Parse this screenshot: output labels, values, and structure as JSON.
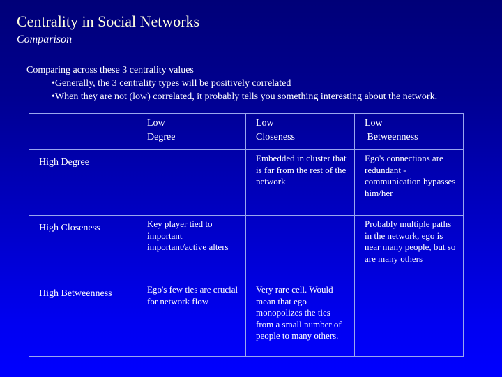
{
  "slide": {
    "title": "Centrality in Social Networks",
    "subtitle": "Comparison",
    "intro": "Comparing across these 3 centrality values",
    "bullets": [
      "•Generally, the 3 centrality types will be positively correlated",
      "•When they are not (low) correlated, it probably tells you something interesting about the network."
    ],
    "colors": {
      "background_top": "#000078",
      "background_bottom": "#0000ff",
      "title_color": "#ffffe0",
      "grid_line": "#9aa6ee"
    }
  },
  "table": {
    "column_headers": [
      "",
      {
        "line1": "Low",
        "line2": "Degree"
      },
      {
        "line1": "Low",
        "line2": "Closeness"
      },
      {
        "line1": "Low",
        "line2": " Betweenness"
      }
    ],
    "rows": [
      {
        "label": "High Degree",
        "cells": [
          "",
          "Embedded in cluster that is far from the rest of the network",
          "Ego's connections are redundant - communication bypasses him/her"
        ]
      },
      {
        "label": "High Closeness",
        "cells": [
          "Key player tied to important important/active alters",
          "",
          "Probably multiple paths in the network, ego is near many people, but so are many others"
        ]
      },
      {
        "label": "High Betweenness",
        "cells": [
          "Ego's few ties are crucial for network flow",
          "Very rare cell.  Would mean that ego monopolizes the ties from a small number of people to many others.",
          ""
        ]
      }
    ]
  }
}
